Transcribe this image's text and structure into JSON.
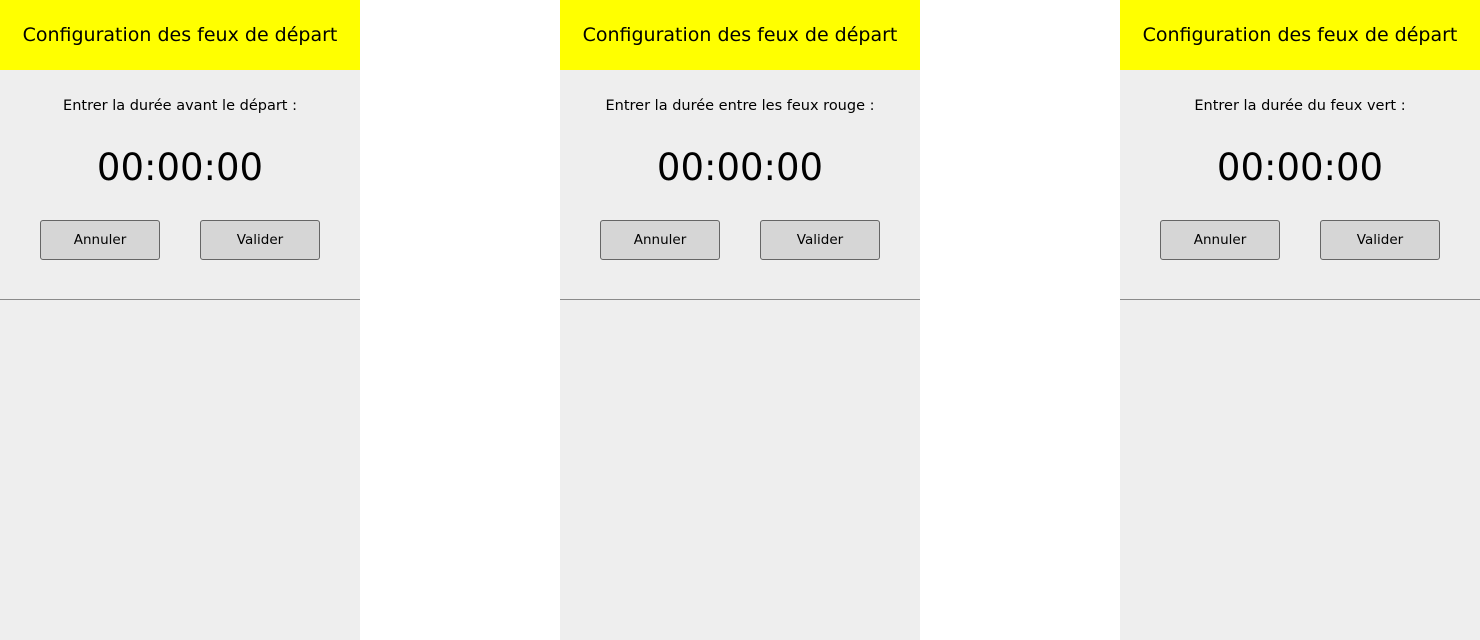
{
  "colors": {
    "header_bg": "#ffff00",
    "panel_bg": "#eeeeee",
    "button_bg": "#d6d6d6",
    "button_border": "#666666"
  },
  "panels": [
    {
      "title": "Configuration des feux de départ",
      "prompt": "Entrer la durée avant le départ :",
      "time": "00:00:00",
      "cancel_label": "Annuler",
      "validate_label": "Valider"
    },
    {
      "title": "Configuration des feux de départ",
      "prompt": "Entrer la durée entre les feux rouge :",
      "time": "00:00:00",
      "cancel_label": "Annuler",
      "validate_label": "Valider"
    },
    {
      "title": "Configuration des feux de départ",
      "prompt": "Entrer la durée du feux vert :",
      "time": "00:00:00",
      "cancel_label": "Annuler",
      "validate_label": "Valider"
    }
  ]
}
